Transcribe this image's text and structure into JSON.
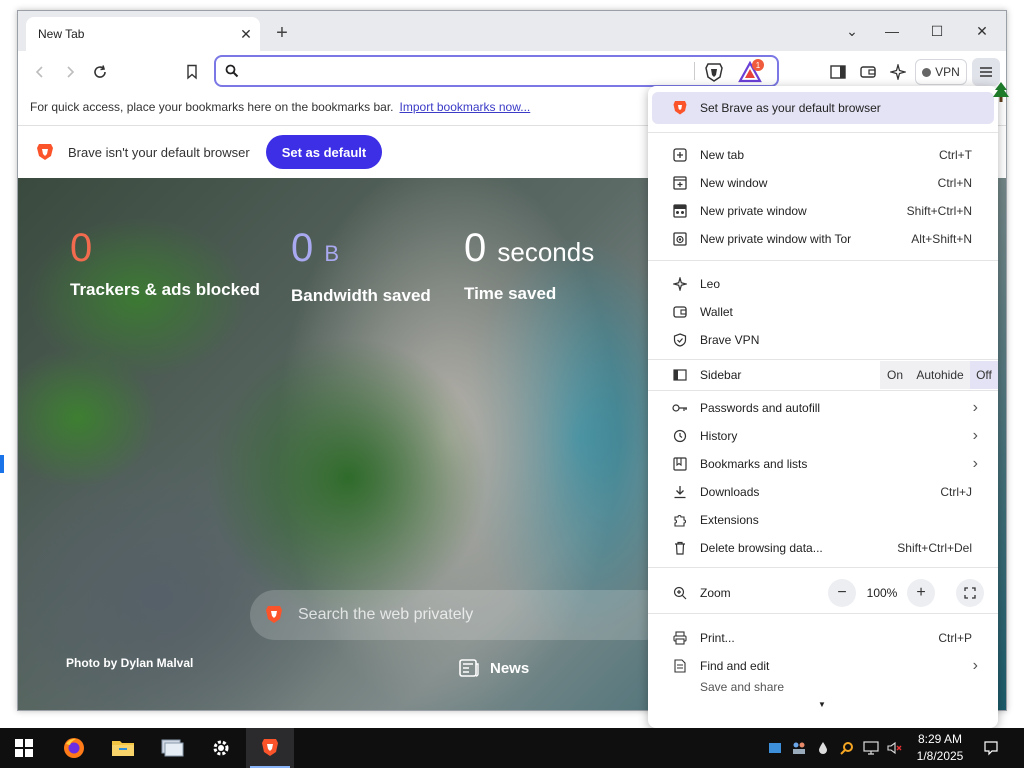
{
  "window": {
    "tab_title": "New Tab",
    "tab_close": "✕",
    "new_tab": "+",
    "controls": {
      "dropdown": "⌄",
      "minimize": "—",
      "maximize": "☐",
      "close": "✕"
    }
  },
  "toolbar": {
    "search_placeholder": "",
    "rewards_badge": "1",
    "vpn_label": "VPN"
  },
  "bookmarks_bar": {
    "hint": "For quick access, place your bookmarks here on the bookmarks bar.",
    "import_link": "Import bookmarks now..."
  },
  "infobar": {
    "message": "Brave isn't your default browser",
    "button": "Set as default"
  },
  "newtab": {
    "stats": [
      {
        "value": "0",
        "unit": "",
        "label": "Trackers & ads blocked",
        "color": "#f26b4f"
      },
      {
        "value": "0",
        "unit": "B",
        "label": "Bandwidth saved",
        "color": "#a8a9f0"
      },
      {
        "value": "0",
        "unit": "seconds",
        "label": "Time saved",
        "color": "#ffffff"
      }
    ],
    "search_placeholder": "Search the web privately",
    "photo_credit": "Photo by Dylan Malval",
    "news_label": "News"
  },
  "menu": {
    "set_default": "Set Brave as your default browser",
    "new_tab": {
      "label": "New tab",
      "shortcut": "Ctrl+T"
    },
    "new_window": {
      "label": "New window",
      "shortcut": "Ctrl+N"
    },
    "new_private": {
      "label": "New private window",
      "shortcut": "Shift+Ctrl+N"
    },
    "new_tor": {
      "label": "New private window with Tor",
      "shortcut": "Alt+Shift+N"
    },
    "leo": "Leo",
    "wallet": "Wallet",
    "vpn": "Brave VPN",
    "sidebar": {
      "label": "Sidebar",
      "on": "On",
      "autohide": "Autohide",
      "off": "Off"
    },
    "passwords": "Passwords and autofill",
    "history": "History",
    "bookmarks": "Bookmarks and lists",
    "downloads": {
      "label": "Downloads",
      "shortcut": "Ctrl+J"
    },
    "extensions": "Extensions",
    "delete_data": {
      "label": "Delete browsing data...",
      "shortcut": "Shift+Ctrl+Del"
    },
    "zoom": {
      "label": "Zoom",
      "minus": "−",
      "value": "100%",
      "plus": "+"
    },
    "print": {
      "label": "Print...",
      "shortcut": "Ctrl+P"
    },
    "find_edit": "Find and edit",
    "save_share": "Save and share"
  },
  "taskbar": {
    "time": "8:29 AM",
    "date": "1/8/2025"
  },
  "colors": {
    "brave_orange": "#fb542b",
    "accent_blue": "#3c2fe6",
    "focus_ring": "#7b78e5"
  }
}
